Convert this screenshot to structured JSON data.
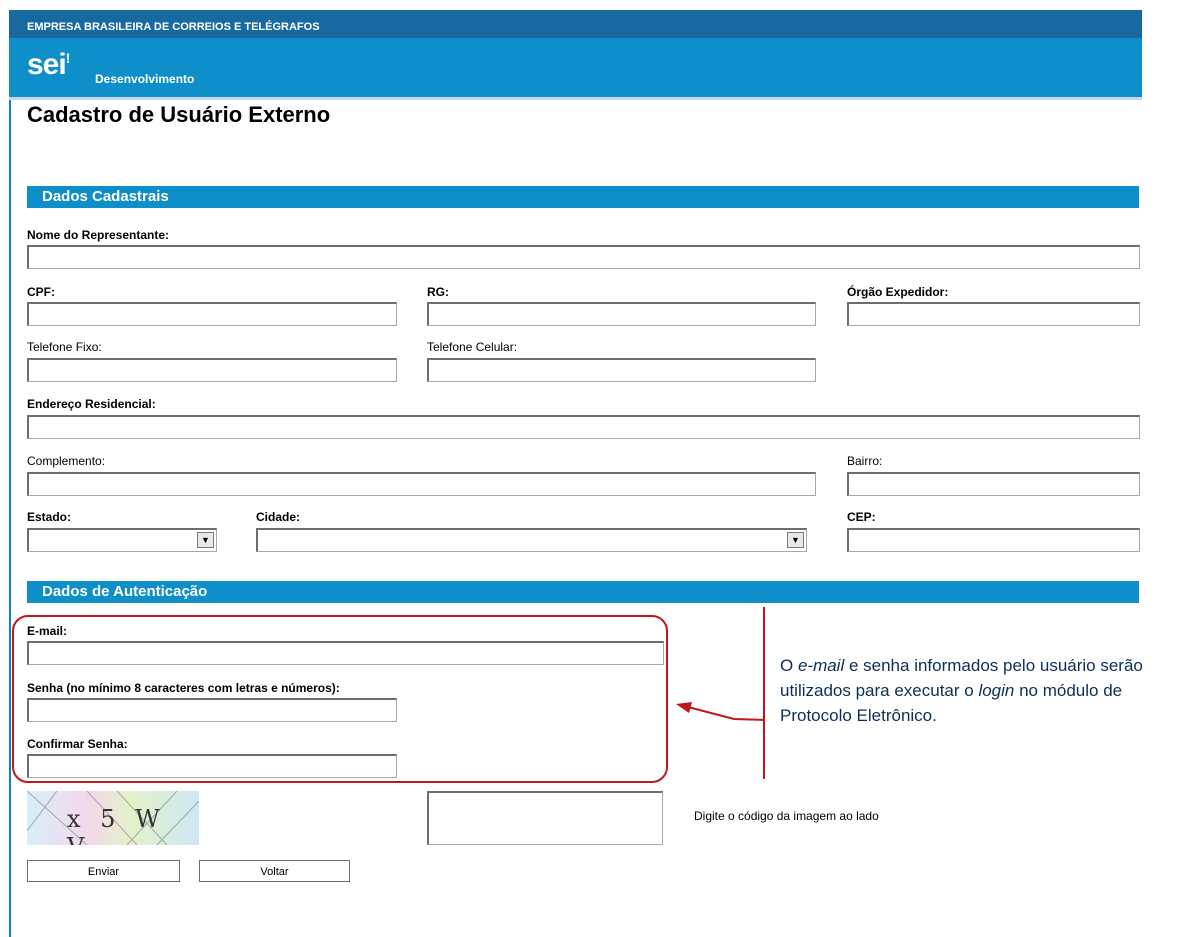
{
  "header": {
    "organization": "EMPRESA BRASILEIRA DE CORREIOS E TELÉGRAFOS",
    "logo_text": "sei",
    "logo_mark": "!",
    "environment": "Desenvolvimento"
  },
  "page_title": "Cadastro de Usuário Externo",
  "sections": {
    "personal": "Dados Cadastrais",
    "auth": "Dados de Autenticação"
  },
  "fields": {
    "nome": "Nome do Representante:",
    "cpf": "CPF:",
    "rg": "RG:",
    "orgao": "Órgão Expedidor:",
    "telefone_fixo": "Telefone Fixo:",
    "telefone_celular": "Telefone Celular:",
    "endereco": "Endereço Residencial:",
    "complemento": "Complemento:",
    "bairro": "Bairro:",
    "estado": "Estado:",
    "cidade": "Cidade:",
    "cep": "CEP:",
    "email": "E-mail:",
    "senha": "Senha (no mínimo 8 caracteres com letras e números):",
    "confirmar_senha": "Confirmar Senha:"
  },
  "captcha": {
    "image_text": "x 5 W V",
    "instruction": "Digite o código da imagem ao lado"
  },
  "buttons": {
    "submit": "Enviar",
    "back": "Voltar"
  },
  "callout": {
    "p1": "O ",
    "email_italic": "e-mail",
    "p2": " e senha informados pelo usuário serão utilizados para executar o ",
    "login_italic": "login",
    "p3": " no módulo de Protocolo Eletrônico."
  },
  "icons": {
    "select_arrow": "chevron-down-icon",
    "callout_arrow": "arrow-left-icon"
  },
  "colors": {
    "header": "#0e8fc9",
    "topbar": "#176aa0",
    "callout": "#c0161d"
  }
}
